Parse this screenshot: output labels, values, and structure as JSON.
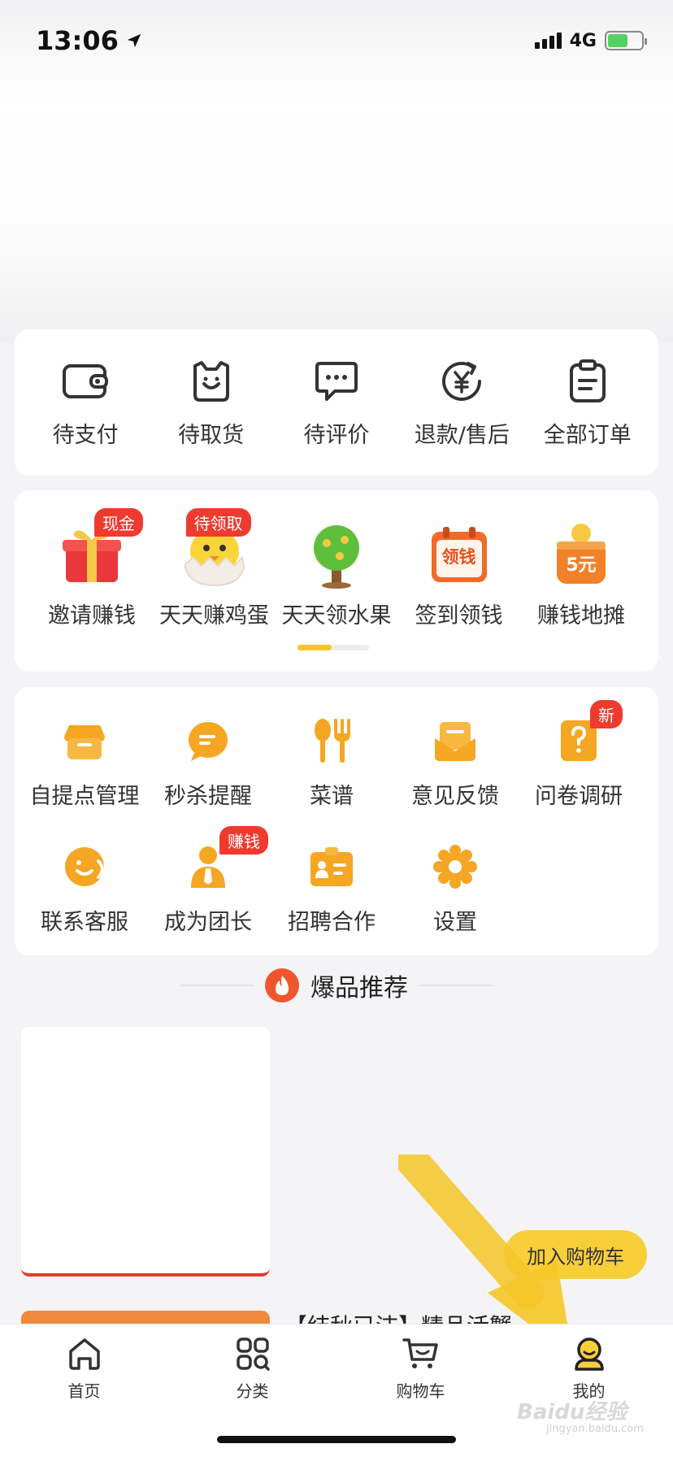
{
  "status_bar": {
    "time": "13:06",
    "network": "4G"
  },
  "orders": [
    {
      "label": "待支付",
      "icon": "wallet-icon"
    },
    {
      "label": "待取货",
      "icon": "bag-icon"
    },
    {
      "label": "待评价",
      "icon": "comment-icon"
    },
    {
      "label": "退款/售后",
      "icon": "refund-icon"
    },
    {
      "label": "全部订单",
      "icon": "clipboard-icon"
    }
  ],
  "activities": [
    {
      "label": "邀请赚钱",
      "badge": "现金"
    },
    {
      "label": "天天赚鸡蛋",
      "badge": "待领取"
    },
    {
      "label": "天天领水果",
      "badge": ""
    },
    {
      "label": "签到领钱",
      "badge": "",
      "pic_text": "领钱"
    },
    {
      "label": "赚钱地摊",
      "badge": "",
      "pic_text": "5元"
    }
  ],
  "tools": [
    {
      "label": "自提点管理",
      "badge": "",
      "icon": "store-icon"
    },
    {
      "label": "秒杀提醒",
      "badge": "",
      "icon": "message-icon"
    },
    {
      "label": "菜谱",
      "badge": "",
      "icon": "utensils-icon"
    },
    {
      "label": "意见反馈",
      "badge": "",
      "icon": "feedback-icon"
    },
    {
      "label": "问卷调研",
      "badge": "新",
      "icon": "question-icon"
    },
    {
      "label": "联系客服",
      "badge": "",
      "icon": "service-icon"
    },
    {
      "label": "成为团长",
      "badge": "赚钱",
      "icon": "leader-icon"
    },
    {
      "label": "招聘合作",
      "badge": "",
      "icon": "recruit-icon"
    },
    {
      "label": "设置",
      "badge": "",
      "icon": "gear-icon"
    }
  ],
  "recommend": {
    "title": "爆品推荐"
  },
  "product": {
    "add_to_cart": "加入购物车",
    "second_title": "【结秋已洁】精品活蟹"
  },
  "tabbar": [
    {
      "label": "首页",
      "icon": "home-icon"
    },
    {
      "label": "分类",
      "icon": "category-icon"
    },
    {
      "label": "购物车",
      "icon": "cart-icon"
    },
    {
      "label": "我的",
      "icon": "profile-icon"
    }
  ],
  "watermark": {
    "text": "Baidu经验",
    "sub": "jingyan.baidu.com"
  },
  "colors": {
    "accent": "#f5c628",
    "badge": "#ee3b2e",
    "icon_orange": "#f5a623"
  }
}
